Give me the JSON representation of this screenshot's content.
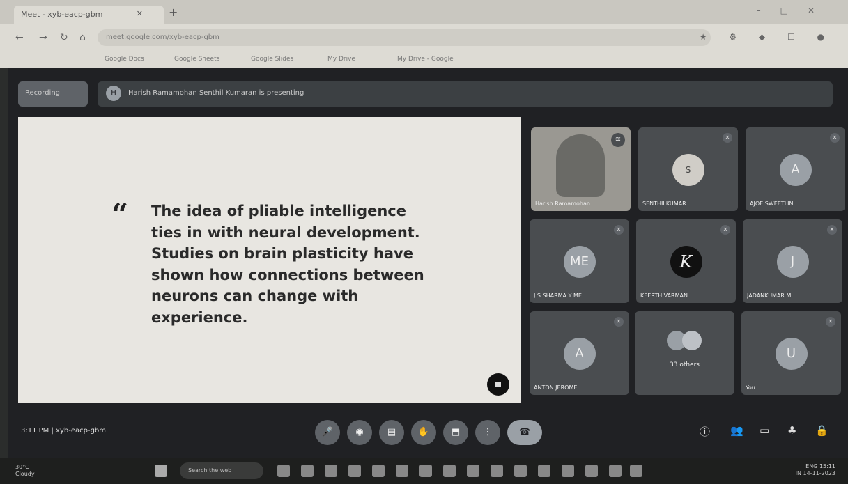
{
  "browser": {
    "tab_title": "Meet - xyb-eacp-gbm",
    "new_tab": "+",
    "url": "meet.google.com/xyb-eacp-gbm",
    "bookmarks": [
      "Google Docs",
      "Google Sheets",
      "Google Slides",
      "My Drive",
      "My Drive - Google"
    ]
  },
  "meet": {
    "recording_label": "Recording",
    "presenting_label": "Harish Ramamohan Senthil Kumaran is presenting",
    "presenter_initial": "H",
    "slide": {
      "quote_mark": "“",
      "quote_text": "The idea of pliable intelligence ties in with neural development. Studies on brain plasticity have shown how connections between neurons can change with experience."
    },
    "participants": [
      {
        "name": "Harish Ramamohan...",
        "avatar": "",
        "type": "speaker"
      },
      {
        "name": "SENTHILKUMAR ...",
        "avatar": "S",
        "type": "photo"
      },
      {
        "name": "AJOE SWEETLIN ...",
        "avatar": "A",
        "type": "letter"
      },
      {
        "name": "J S SHARMA Y ME",
        "avatar": "ME",
        "type": "letter"
      },
      {
        "name": "KEERTHIVARMAN...",
        "avatar": "K",
        "type": "dark"
      },
      {
        "name": "JADANKUMAR M...",
        "avatar": "J",
        "type": "letter"
      },
      {
        "name": "ANTON JEROME ...",
        "avatar": "A",
        "type": "letter"
      },
      {
        "name": "",
        "avatar": "",
        "type": "others",
        "others_label": "33 others"
      },
      {
        "name": "You",
        "avatar": "U",
        "type": "letter"
      }
    ],
    "footer": {
      "time": "3:11 PM",
      "separator": "|",
      "meeting_code": "xyb-eacp-gbm"
    }
  },
  "taskbar": {
    "weather_temp": "30°C",
    "weather_desc": "Cloudy",
    "search_placeholder": "Search the web",
    "lang": "ENG",
    "lang2": "IN",
    "clock_time": "15:11",
    "clock_date": "14-11-2023"
  }
}
